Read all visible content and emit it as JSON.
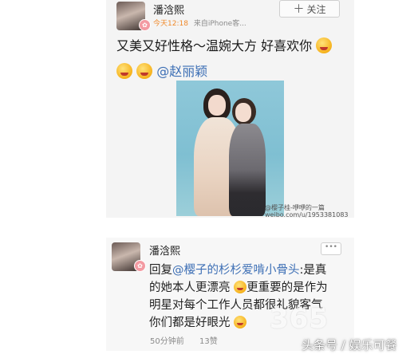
{
  "post": {
    "username": "潘浛熙",
    "time": "今天12:18",
    "source": "来自iPhone客...",
    "follow_label": "关注",
    "follow_icon": "plus-icon",
    "text_line1": "又美又好性格～温婉大方 好喜欢你",
    "mention": "@赵丽颖",
    "photo_watermark_line1": "@樱子桂-咿咿的一篇",
    "photo_watermark_line2": "weibo.com/u/1953381083"
  },
  "reply": {
    "username": "潘浛熙",
    "more_label": "•••",
    "line1_prefix": "回复",
    "line1_mention": "@樱子的杉杉爱啃小骨头",
    "line1_suffix": ":是真",
    "line2_a": "的她本人更漂亮",
    "line2_b": "更重要的是作为",
    "line3": "明星对每个工作人员都很礼貌客气",
    "line4": "你们都是好眼光",
    "time": "50分钟前",
    "likes": "13赞"
  },
  "overlay": {
    "logo": "365",
    "source_mark": "头条号 / 娱乐可餐"
  },
  "colors": {
    "link": "#3d6fb5",
    "time_orange": "#f08a2c",
    "vip_badge": "#f39aa2"
  }
}
